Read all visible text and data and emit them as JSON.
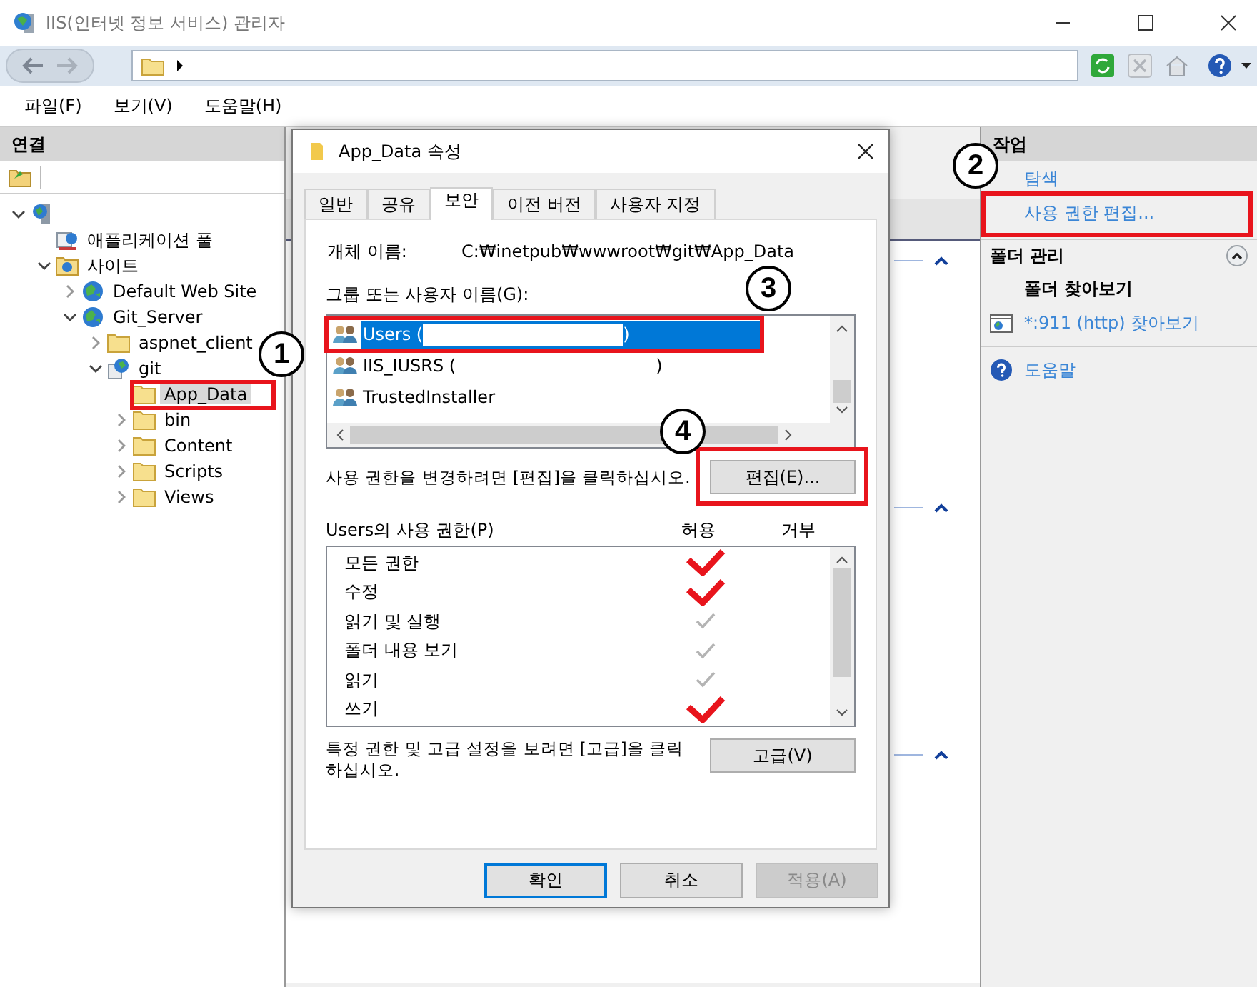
{
  "window": {
    "title": "IIS(인터넷 정보 서비스) 관리자"
  },
  "menu": [
    "파일(F)",
    "보기(V)",
    "도움말(H)"
  ],
  "connections": {
    "title": "연결",
    "tree": [
      {
        "kind": "server",
        "expandable": true,
        "expanded": true,
        "selected": false,
        "children": [
          {
            "kind": "pool",
            "label": "애플리케이션 풀",
            "expandable": false,
            "selected": false
          },
          {
            "kind": "sites",
            "label": "사이트",
            "expandable": true,
            "expanded": true,
            "selected": false,
            "children": [
              {
                "kind": "site",
                "label": "Default Web Site",
                "expandable": true,
                "expanded": false,
                "selected": false
              },
              {
                "kind": "site",
                "label": "Git_Server",
                "expandable": true,
                "expanded": true,
                "selected": false,
                "children": [
                  {
                    "kind": "folder",
                    "label": "aspnet_client",
                    "expandable": true,
                    "expanded": false,
                    "selected": false
                  },
                  {
                    "kind": "app",
                    "label": "git",
                    "expandable": true,
                    "expanded": true,
                    "selected": false,
                    "children": [
                      {
                        "kind": "folder",
                        "label": "App_Data",
                        "expandable": false,
                        "selected": true
                      },
                      {
                        "kind": "folder",
                        "label": "bin",
                        "expandable": true,
                        "expanded": false,
                        "selected": false
                      },
                      {
                        "kind": "folder",
                        "label": "Content",
                        "expandable": true,
                        "expanded": false,
                        "selected": false
                      },
                      {
                        "kind": "folder",
                        "label": "Scripts",
                        "expandable": true,
                        "expanded": false,
                        "selected": false
                      },
                      {
                        "kind": "folder",
                        "label": "Views",
                        "expandable": true,
                        "expanded": false,
                        "selected": false
                      }
                    ]
                  }
                ]
              }
            ]
          }
        ]
      }
    ]
  },
  "actions": {
    "title": "작업",
    "items": [
      {
        "kind": "link",
        "label": "탐색"
      },
      {
        "kind": "link",
        "label": "사용 권한 편집..."
      },
      {
        "kind": "section",
        "label": "폴더 관리",
        "expanded": true
      },
      {
        "kind": "heading",
        "label": "폴더 찾아보기"
      },
      {
        "kind": "browse",
        "label": "*:911 (http) 찾아보기"
      },
      {
        "kind": "help",
        "label": "도움말"
      }
    ]
  },
  "dialog": {
    "title": "App_Data 속성",
    "tabs": [
      {
        "label": "일반",
        "selected": false
      },
      {
        "label": "공유",
        "selected": false
      },
      {
        "label": "보안",
        "selected": true
      },
      {
        "label": "이전 버전",
        "selected": false
      },
      {
        "label": "사용자 지정",
        "selected": false
      }
    ],
    "object_label": "개체 이름:",
    "object_name": "C:₩inetpub₩wwwroot₩git₩App_Data",
    "groups_label": "그룹 또는 사용자 이름(G):",
    "users": [
      {
        "name": "Users (",
        "suffix": ")",
        "redacted": true,
        "selected": true
      },
      {
        "name": "IIS_IUSRS (",
        "suffix": ")",
        "selected": false
      },
      {
        "name": "TrustedInstaller",
        "selected": false
      }
    ],
    "edit_hint": "사용 권한을 변경하려면 [편집]을 클릭하십시오.",
    "edit_button": "편집(E)...",
    "permissions_label": "Users의 사용 권한(P)",
    "allow_header": "허용",
    "deny_header": "거부",
    "permissions": [
      {
        "name": "모든 권한",
        "allowed": true,
        "marked": true
      },
      {
        "name": "수정",
        "allowed": true,
        "marked": true
      },
      {
        "name": "읽기 및 실행",
        "allowed": true,
        "marked": false
      },
      {
        "name": "폴더 내용 보기",
        "allowed": true,
        "marked": false
      },
      {
        "name": "읽기",
        "allowed": true,
        "marked": false
      },
      {
        "name": "쓰기",
        "allowed": true,
        "marked": true
      }
    ],
    "advanced_hint": "특정 권한 및 고급 설정을 보려면 [고급]을 클릭하십시오.",
    "advanced_button": "고급(V)",
    "buttons": [
      {
        "label": "확인",
        "default": true,
        "disabled": false
      },
      {
        "label": "취소",
        "default": false,
        "disabled": false
      },
      {
        "label": "적용(A)",
        "default": false,
        "disabled": true
      }
    ]
  },
  "annotations": [
    {
      "label": "1"
    },
    {
      "label": "2"
    },
    {
      "label": "3"
    },
    {
      "label": "4"
    }
  ]
}
